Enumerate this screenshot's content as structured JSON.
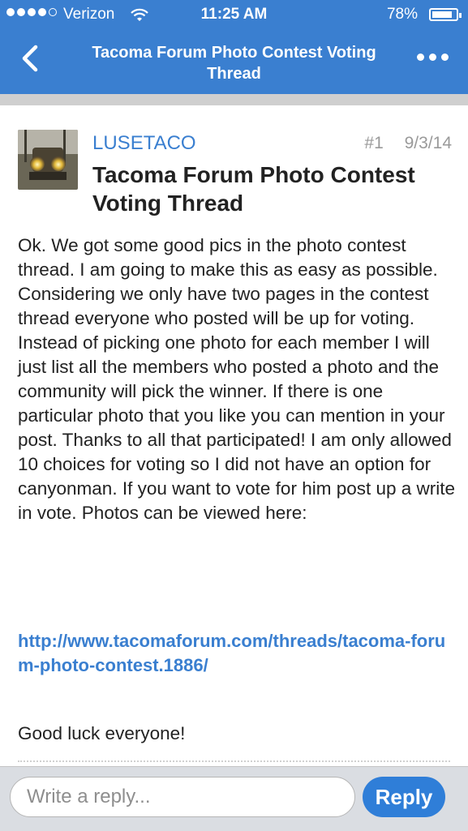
{
  "status_bar": {
    "carrier": "Verizon",
    "time": "11:25 AM",
    "battery_percent": "78%",
    "battery_level": 0.78,
    "signal_bars": 4
  },
  "nav": {
    "title": "Tacoma Forum Photo Contest Voting Thread",
    "back_icon": "chevron-left-icon",
    "more_icon": "more-dots-icon"
  },
  "post": {
    "username": "LUSETACO",
    "post_number": "#1",
    "date": "9/3/14",
    "title": "Tacoma Forum Photo Contest Voting Thread",
    "body": "Ok. We got some good pics in the photo contest thread. I am going to make this as easy as possible. Considering we only have two pages in the contest thread everyone who posted will be up for voting. Instead of picking one photo for each member I will just list all the members who posted a photo and the community will pick the winner. If there is one particular photo that you like you can mention in your post. Thanks to all that participated! I am only allowed 10 choices for voting so I did not have an option for canyonman. If you want to vote for him post up a write in vote. Photos can be viewed here:",
    "link": "http://www.tacomaforum.com/threads/tacoma-forum-photo-contest.1886/",
    "closing": "Good luck everyone!"
  },
  "reply": {
    "placeholder": "Write a reply...",
    "button_label": "Reply"
  },
  "colors": {
    "accent": "#3a7fd0",
    "reply_button": "#2f7ed8",
    "meta_gray": "#9a9a9a"
  }
}
